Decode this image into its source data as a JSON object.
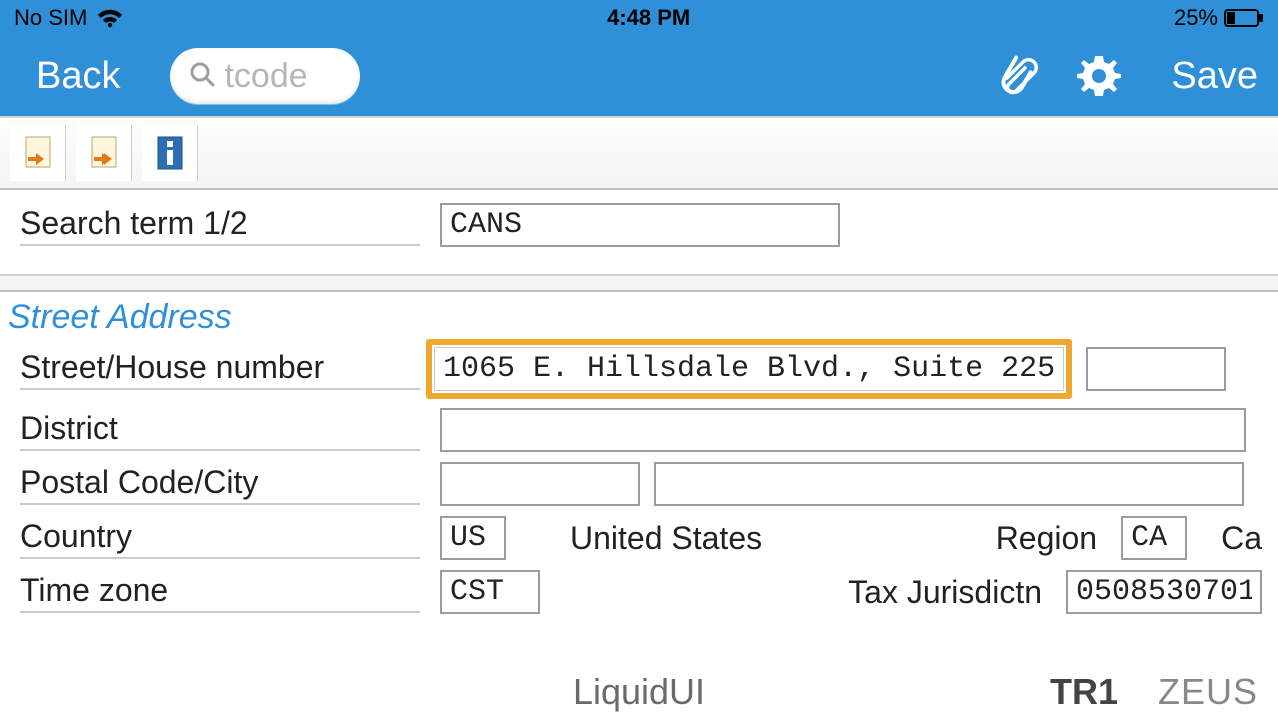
{
  "statusbar": {
    "carrier": "No SIM",
    "time": "4:48 PM",
    "battery_pct": "25%"
  },
  "nav": {
    "back_label": "Back",
    "search_placeholder": "tcode",
    "save_label": "Save"
  },
  "form": {
    "search_term_label": "Search term 1/2",
    "search_term_value": "CANS",
    "section_title": "Street Address",
    "street_label": "Street/House number",
    "street_value": "1065 E. Hillsdale Blvd., Suite 225",
    "house_value": "",
    "district_label": "District",
    "district_value": "",
    "postal_label": "Postal Code/City",
    "postal_value": "",
    "city_value": "",
    "country_label": "Country",
    "country_code": "US",
    "country_name": "United States",
    "region_label": "Region",
    "region_code": "CA",
    "region_name_partial": "Ca",
    "timezone_label": "Time zone",
    "timezone_value": "CST",
    "taxjur_label": "Tax Jurisdictn",
    "taxjur_value": "0508530701"
  },
  "footer": {
    "center": "LiquidUI",
    "system": "TR1",
    "server": "ZEUS"
  }
}
